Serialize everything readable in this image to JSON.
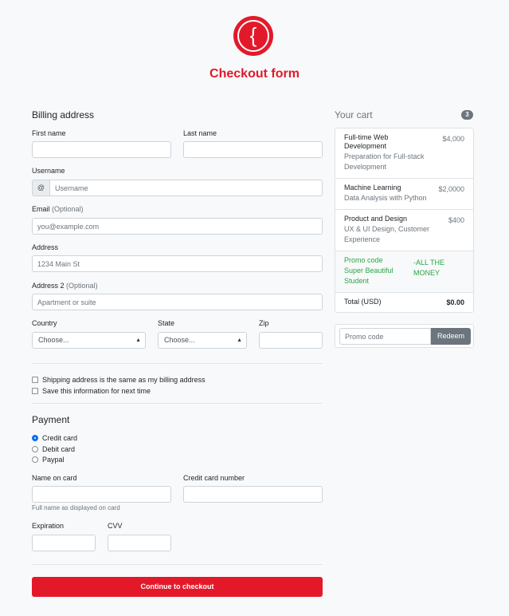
{
  "header": {
    "logo_icon": "bracket-logo-icon",
    "logo_glyph": "{",
    "title": "Checkout form",
    "brand_color": "#e3192a"
  },
  "billing": {
    "heading": "Billing address",
    "first_name": {
      "label": "First name",
      "value": "",
      "placeholder": ""
    },
    "last_name": {
      "label": "Last name",
      "value": "",
      "placeholder": ""
    },
    "username": {
      "label": "Username",
      "addon": "@",
      "placeholder": "Username"
    },
    "email": {
      "label": "Email",
      "optional": "(Optional)",
      "placeholder": "you@example.com"
    },
    "address": {
      "label": "Address",
      "placeholder": "1234 Main St"
    },
    "address2": {
      "label": "Address 2",
      "optional": "(Optional)",
      "placeholder": "Apartment or suite"
    },
    "country": {
      "label": "Country",
      "selected": "Choose..."
    },
    "state": {
      "label": "State",
      "selected": "Choose..."
    },
    "zip": {
      "label": "Zip",
      "placeholder": ""
    },
    "same_address": "Shipping address is the same as my billing address",
    "save_info": "Save this information for next time"
  },
  "payment": {
    "heading": "Payment",
    "methods": [
      "Credit card",
      "Debit card",
      "Paypal"
    ],
    "selected_method": "Credit card",
    "name_on_card": {
      "label": "Name on card",
      "help": "Full name as displayed on card"
    },
    "card_number": {
      "label": "Credit card number"
    },
    "expiration": {
      "label": "Expiration"
    },
    "cvv": {
      "label": "CVV"
    },
    "submit_label": "Continue to checkout"
  },
  "cart": {
    "title": "Your cart",
    "count": "3",
    "items": [
      {
        "name": "Full-time Web Development",
        "desc": "Preparation for Full-stack Development",
        "price": "$4,000"
      },
      {
        "name": "Machine Learning",
        "desc": "Data Analysis with Python",
        "price": "$2,0000"
      },
      {
        "name": "Product and Design",
        "desc": "UX & UI Design, Customer Experience",
        "price": "$400"
      }
    ],
    "promo": {
      "name": "Promo code",
      "desc": "Super Beautiful Student",
      "value": "-ALL THE MONEY"
    },
    "total": {
      "label": "Total (USD)",
      "value": "$0.00"
    },
    "promo_input_placeholder": "Promo code",
    "redeem_label": "Redeem"
  }
}
